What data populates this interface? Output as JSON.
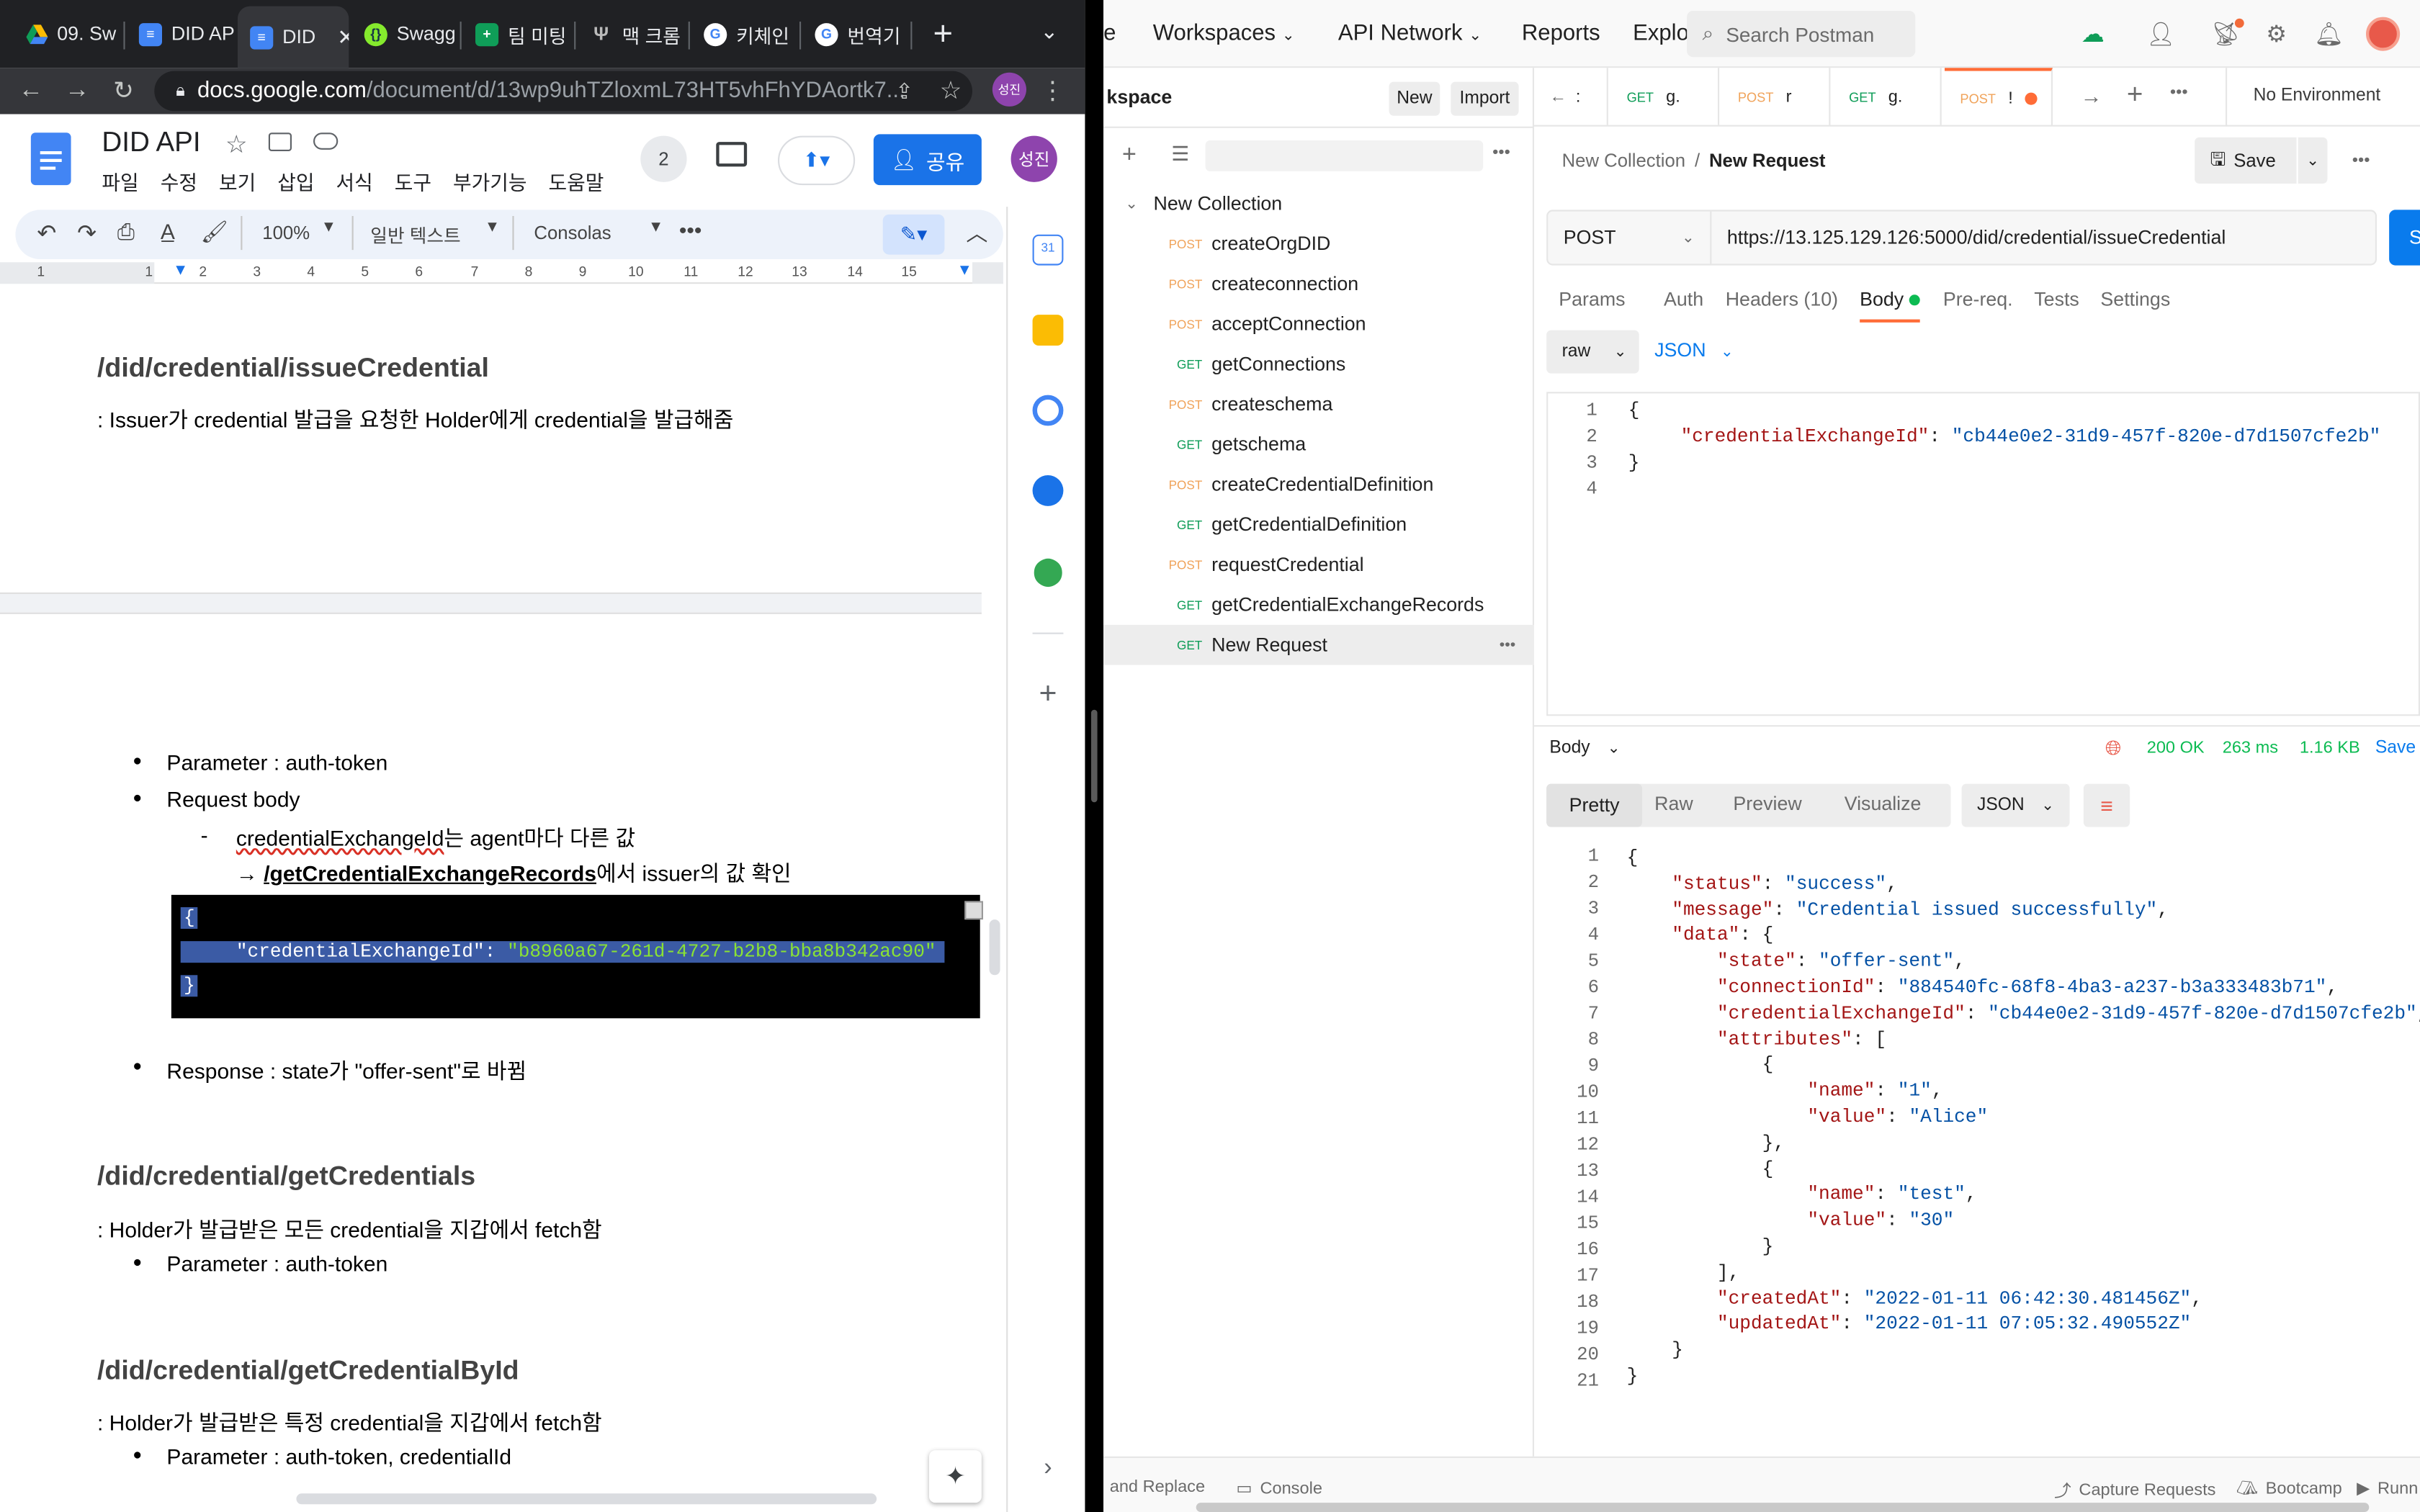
{
  "browser": {
    "tabs": [
      {
        "label": "09. Sw",
        "icon": "google-drive-icon",
        "color": "#fbbc04"
      },
      {
        "label": "DID AP",
        "icon": "google-docs-icon",
        "color": "#4285f4"
      },
      {
        "label": "DID",
        "icon": "google-docs-icon",
        "color": "#4285f4",
        "active": true
      },
      {
        "label": "Swagg",
        "icon": "swagger-icon",
        "color": "#85ea2d"
      },
      {
        "label": "팀 미팅",
        "icon": "google-sheets-icon",
        "color": "#0f9d58"
      },
      {
        "label": "맥 크롬",
        "icon": "velog-icon",
        "color": "#333333"
      },
      {
        "label": "키체인",
        "icon": "google-icon",
        "color": "#ffffff"
      },
      {
        "label": "번역기",
        "icon": "google-icon",
        "color": "#ffffff"
      }
    ],
    "url_host": "docs.google.com",
    "url_path": "/document/d/13wp9uhTZloxmL73HT5vhFhYDAortk7...",
    "profile_initial": "성진"
  },
  "docs": {
    "title": "DID API",
    "menu": [
      "파일",
      "수정",
      "보기",
      "삽입",
      "서식",
      "도구",
      "부가기능",
      "도움말"
    ],
    "share_label": "공유",
    "user_initial": "성진",
    "collaborators_count": "2",
    "toolbar": {
      "zoom": "100%",
      "style": "일반 텍스트",
      "font": "Consolas"
    },
    "ruler_numbers": [
      "1",
      "1",
      "2",
      "3",
      "4",
      "5",
      "6",
      "7",
      "8",
      "9",
      "10",
      "11",
      "12",
      "13",
      "14",
      "15"
    ],
    "content": {
      "h1": "/did/credential/issueCredential",
      "p1": ": Issuer가 credential 발급을 요청한 Holder에게 credential을 발급해줌",
      "bullet_param": "Parameter : auth-token",
      "bullet_body": "Request body",
      "sub_dash": "-",
      "sub1_pre": "credentialExchangeId",
      "sub1_post": "는 agent마다 다른 값",
      "sub2_arrow": "→ ",
      "sub2_link": "/getCredentialExchangeRecords",
      "sub2_post": "에서 issuer의 값 확인",
      "code_open": "{",
      "code_key": "\"credentialExchangeId\"",
      "code_colon": ": ",
      "code_val": "\"b8960a67-261d-4727-b2b8-bba8b342ac90\"",
      "code_close": "}",
      "bullet_response": "Response : state가 \"offer-sent\"로 바뀜",
      "h2": "/did/credential/getCredentials",
      "p2": ": Holder가 발급받은 모든 credential을 지갑에서 fetch함",
      "bullet_param2": "Parameter : auth-token",
      "h3": "/did/credential/getCredentialById",
      "p3": ": Holder가 발급받은 특정 credential을 지갑에서 fetch함",
      "bullet_param3": "Parameter : auth-token, credentialId"
    }
  },
  "postman": {
    "nav": {
      "home_fragment": "e",
      "workspaces": "Workspaces",
      "api_network": "API Network",
      "reports": "Reports",
      "explore": "Explo",
      "search_placeholder": "Search Postman"
    },
    "sidebar": {
      "workspace_label": "kspace",
      "new_button": "New",
      "import_button": "Import",
      "collection": "New Collection",
      "items": [
        {
          "method": "POST",
          "name": "createOrgDID"
        },
        {
          "method": "POST",
          "name": "createconnection"
        },
        {
          "method": "POST",
          "name": "acceptConnection"
        },
        {
          "method": "GET",
          "name": "getConnections"
        },
        {
          "method": "POST",
          "name": "createschema"
        },
        {
          "method": "GET",
          "name": "getschema"
        },
        {
          "method": "POST",
          "name": "createCredentialDefinition"
        },
        {
          "method": "GET",
          "name": "getCredentialDefinition"
        },
        {
          "method": "POST",
          "name": "requestCredential"
        },
        {
          "method": "GET",
          "name": "getCredentialExchangeRecords"
        },
        {
          "method": "GET",
          "name": "New Request"
        }
      ]
    },
    "tabs": [
      {
        "method": "",
        "name": ":"
      },
      {
        "method": "GET",
        "name": "g."
      },
      {
        "method": "POST",
        "name": "r"
      },
      {
        "method": "GET",
        "name": "g."
      },
      {
        "method": "POST",
        "name": "!"
      }
    ],
    "environment": "No Environment",
    "breadcrumb": {
      "collection": "New Collection",
      "sep": "/",
      "request": "New Request"
    },
    "save_label": "Save",
    "request": {
      "method": "POST",
      "url": "https://13.125.129.126:5000/did/credential/issueCredential",
      "send_fragment": "S"
    },
    "req_tabs": [
      {
        "label": "Params"
      },
      {
        "label": "Auth"
      },
      {
        "label": "Headers (10)"
      },
      {
        "label": "Body",
        "active": true
      },
      {
        "label": "Pre-req."
      },
      {
        "label": "Tests"
      },
      {
        "label": "Settings"
      }
    ],
    "body_type": "raw",
    "body_lang": "JSON",
    "request_body": {
      "lines": [
        "1",
        "2",
        "3",
        "4"
      ],
      "open": "{",
      "key": "\"credentialExchangeId\"",
      "colon": ": ",
      "value": "\"cb44e0e2-31d9-457f-820e-d7d1507cfe2b\"",
      "close": "}"
    },
    "response": {
      "label": "Body",
      "status": "200 OK",
      "time": "263 ms",
      "size": "1.16 KB",
      "save": "Save",
      "views": [
        "Pretty",
        "Raw",
        "Preview",
        "Visualize"
      ],
      "format": "JSON",
      "line_numbers": [
        "1",
        "2",
        "3",
        "4",
        "5",
        "6",
        "7",
        "8",
        "9",
        "10",
        "11",
        "12",
        "13",
        "14",
        "15",
        "16",
        "17",
        "18",
        "19",
        "20",
        "21"
      ],
      "json": {
        "status": "\"success\"",
        "message": "\"Credential issued successfully\"",
        "state": "\"offer-sent\"",
        "connectionId": "\"884540fc-68f8-4ba3-a237-b3a333483b71\"",
        "credentialExchangeId": "\"cb44e0e2-31d9-457f-820e-d7d1507cfe2b\"",
        "attr1_name": "\"1\"",
        "attr1_value": "\"Alice\"",
        "attr2_name": "\"test\"",
        "attr2_value": "\"30\"",
        "createdAt": "\"2022-01-11 06:42:30.481456Z\"",
        "updatedAt": "\"2022-01-11 07:05:32.490552Z\""
      }
    },
    "status_bar": {
      "find_replace": "and Replace",
      "console": "Console",
      "capture": "Capture Requests",
      "bootcamp": "Bootcamp",
      "runner": "Runn"
    }
  }
}
